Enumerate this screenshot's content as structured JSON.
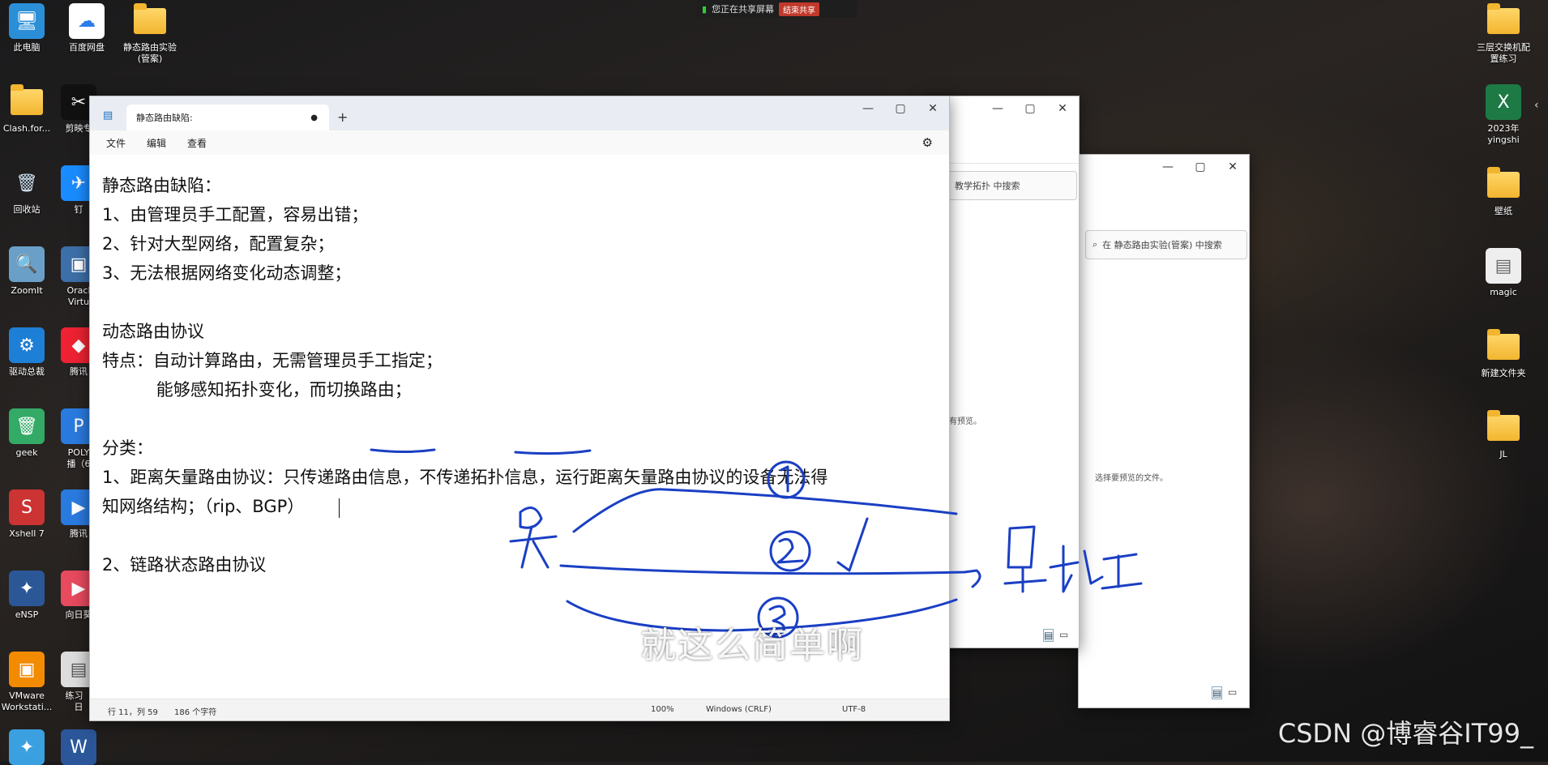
{
  "share_bar": {
    "status": "您正在共享屏幕",
    "stop_label": "结束共享"
  },
  "desktop_left": [
    {
      "label": "此电脑",
      "icon": "computer-icon"
    },
    {
      "label": "百度网盘",
      "icon": "baidu-netdisk-icon"
    },
    {
      "label": "静态路由实验\n(管案)",
      "icon": "folder-icon"
    },
    {
      "label": "Clash.for...",
      "icon": "folder-icon"
    },
    {
      "label": "剪映专",
      "icon": "jianying-icon"
    },
    {
      "label": "回收站",
      "icon": "recycle-bin-icon"
    },
    {
      "label": "钉",
      "icon": "dingtalk-icon"
    },
    {
      "label": "ZoomIt",
      "icon": "zoomit-icon"
    },
    {
      "label": "Oracl\nVirtu",
      "icon": "virtualbox-icon"
    },
    {
      "label": "驱动总裁",
      "icon": "driver-icon"
    },
    {
      "label": "腾讯",
      "icon": "tencent-icon"
    },
    {
      "label": "geek",
      "icon": "geek-icon"
    },
    {
      "label": "POLY\n播（6",
      "icon": "poly-icon"
    },
    {
      "label": "Xshell 7",
      "icon": "xshell-icon"
    },
    {
      "label": "腾讯",
      "icon": "tencent-meeting-icon"
    },
    {
      "label": "eNSP",
      "icon": "ensp-icon"
    },
    {
      "label": "向日葵",
      "icon": "sunlogin-icon"
    },
    {
      "label": "VMware\nWorkstati...",
      "icon": "vmware-icon"
    },
    {
      "label": "练习（\n日",
      "icon": "document-icon"
    },
    {
      "label": "",
      "icon": "app-icon"
    },
    {
      "label": "",
      "icon": "word-icon"
    }
  ],
  "desktop_right": [
    {
      "label": "三层交换机配\n置练习",
      "icon": "folder-icon"
    },
    {
      "label": "2023年\nyingshi",
      "icon": "excel-icon"
    },
    {
      "label": "壁纸",
      "icon": "folder-icon"
    },
    {
      "label": "magic",
      "icon": "file-icon"
    },
    {
      "label": "新建文件夹",
      "icon": "folder-icon"
    },
    {
      "label": "JL",
      "icon": "folder-icon"
    }
  ],
  "notepad": {
    "tab_title": "静态路由缺陷:",
    "menu": [
      "文件",
      "编辑",
      "查看"
    ],
    "lines": [
      "静态路由缺陷：",
      "1、由管理员手工配置，容易出错；",
      "2、针对大型网络，配置复杂；",
      "3、无法根据网络变化动态调整；",
      "",
      "动态路由协议",
      "特点：自动计算路由，无需管理员手工指定；",
      "          能够感知拓扑变化，而切换路由；",
      "",
      "分类：",
      "1、距离矢量路由协议：只传递路由信息，不传递拓扑信息，运行距离矢量路由协议的设备无法得",
      "知网络结构；（rip、BGP）",
      "",
      "2、链路状态路由协议"
    ],
    "status": {
      "position": "行 11，列 59",
      "chars": "186 个字符",
      "zoom": "100%",
      "eol": "Windows (CRLF)",
      "encoding": "UTF-8"
    }
  },
  "explorer1": {
    "search_placeholder": "教学拓扑 中搜索",
    "preview_text": "没有预览。"
  },
  "explorer2": {
    "search_placeholder": "在 静态路由实验(管案) 中搜索",
    "preview_text": "选择要预览的文件。"
  },
  "annotation": {
    "caption": "就这么简单啊"
  },
  "watermark": "CSDN @博睿谷IT99_"
}
